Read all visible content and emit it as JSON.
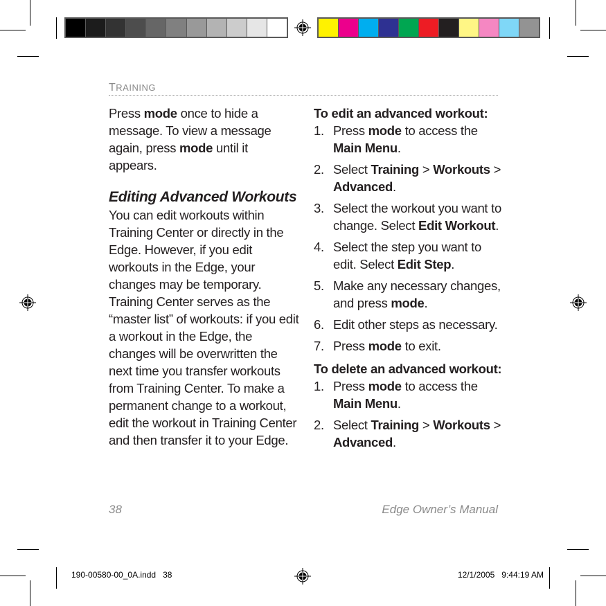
{
  "color_bar_gray": [
    "#000000",
    "#1c1c1c",
    "#333333",
    "#4d4d4d",
    "#666666",
    "#808080",
    "#999999",
    "#b3b3b3",
    "#cccccc",
    "#e6e6e6",
    "#ffffff"
  ],
  "color_bar_process": [
    "#fff200",
    "#ec008c",
    "#00aeef",
    "#2e3192",
    "#00a651",
    "#ed1c24",
    "#231f20",
    "#fff685",
    "#f587c2",
    "#7fd7f7",
    "#939393"
  ],
  "header": {
    "section_first": "T",
    "section_rest": "RAINING"
  },
  "left_column": {
    "intro": [
      {
        "t": "Press ",
        "b": false
      },
      {
        "t": "mode",
        "b": true
      },
      {
        "t": " once to hide a message. To view a message again, press ",
        "b": false
      },
      {
        "t": "mode",
        "b": true
      },
      {
        "t": " until it appears.",
        "b": false
      }
    ],
    "heading": "Editing Advanced Workouts",
    "body": "You can edit workouts within Training Center or directly in the Edge. However, if you edit workouts in the Edge, your changes may be temporary. Training Center serves as the “master list” of workouts: if you edit a workout in the Edge, the changes will be overwritten the next time you transfer workouts from Training Center. To make a permanent change to a workout, edit the workout in Training Center and then transfer it to your Edge."
  },
  "right_column": {
    "procedures": [
      {
        "title": "To edit an advanced workout:",
        "steps": [
          {
            "num": "1.",
            "parts": [
              {
                "t": "Press ",
                "b": false
              },
              {
                "t": "mode",
                "b": true
              },
              {
                "t": " to access the ",
                "b": false
              },
              {
                "t": "Main Menu",
                "b": true
              },
              {
                "t": ".",
                "b": false
              }
            ]
          },
          {
            "num": "2.",
            "parts": [
              {
                "t": "Select ",
                "b": false
              },
              {
                "t": "Training",
                "b": true
              },
              {
                "t": " > ",
                "b": false
              },
              {
                "t": "Workouts",
                "b": true
              },
              {
                "t": " > ",
                "b": false
              },
              {
                "t": "Advanced",
                "b": true
              },
              {
                "t": ".",
                "b": false
              }
            ]
          },
          {
            "num": "3.",
            "parts": [
              {
                "t": "Select the workout you want to change. Select ",
                "b": false
              },
              {
                "t": "Edit Workout",
                "b": true
              },
              {
                "t": ".",
                "b": false
              }
            ]
          },
          {
            "num": "4.",
            "parts": [
              {
                "t": "Select the step you want to edit. Select ",
                "b": false
              },
              {
                "t": "Edit Step",
                "b": true
              },
              {
                "t": ".",
                "b": false
              }
            ]
          },
          {
            "num": "5.",
            "parts": [
              {
                "t": "Make any necessary changes, and press ",
                "b": false
              },
              {
                "t": "mode",
                "b": true
              },
              {
                "t": ".",
                "b": false
              }
            ]
          },
          {
            "num": "6.",
            "parts": [
              {
                "t": "Edit other steps as necessary.",
                "b": false
              }
            ]
          },
          {
            "num": "7.",
            "parts": [
              {
                "t": "Press ",
                "b": false
              },
              {
                "t": "mode",
                "b": true
              },
              {
                "t": " to exit.",
                "b": false
              }
            ]
          }
        ]
      },
      {
        "title": "To delete an advanced workout:",
        "steps": [
          {
            "num": "1.",
            "parts": [
              {
                "t": "Press ",
                "b": false
              },
              {
                "t": "mode",
                "b": true
              },
              {
                "t": " to access the ",
                "b": false
              },
              {
                "t": "Main Menu",
                "b": true
              },
              {
                "t": ".",
                "b": false
              }
            ]
          },
          {
            "num": "2.",
            "parts": [
              {
                "t": "Select ",
                "b": false
              },
              {
                "t": "Training",
                "b": true
              },
              {
                "t": " > ",
                "b": false
              },
              {
                "t": "Workouts",
                "b": true
              },
              {
                "t": " > ",
                "b": false
              },
              {
                "t": "Advanced",
                "b": true
              },
              {
                "t": ".",
                "b": false
              }
            ]
          }
        ]
      }
    ]
  },
  "footer": {
    "page_number": "38",
    "manual_title": "Edge Owner’s Manual"
  },
  "slug": {
    "file": "190-00580-00_0A.indd   38",
    "timestamp": "12/1/2005   9:44:19 AM"
  }
}
